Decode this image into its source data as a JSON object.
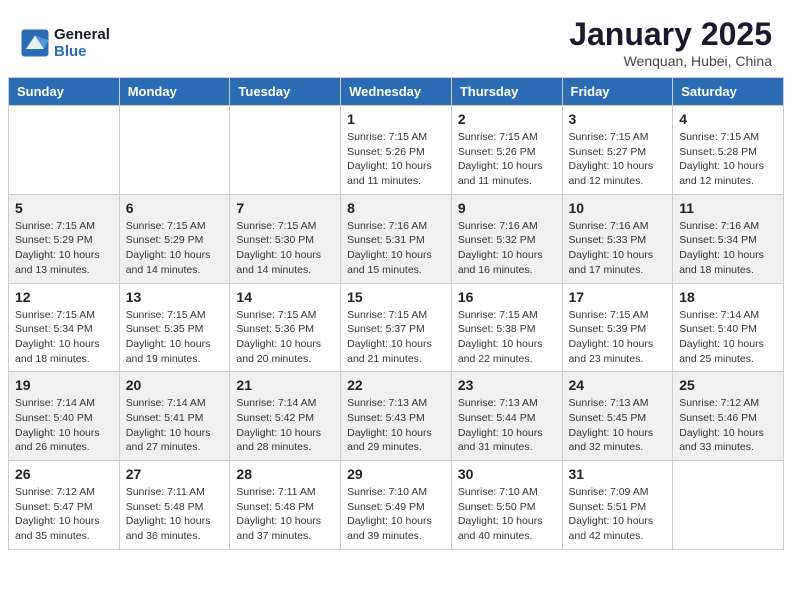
{
  "header": {
    "logo_line1": "General",
    "logo_line2": "Blue",
    "month": "January 2025",
    "location": "Wenquan, Hubei, China"
  },
  "days_of_week": [
    "Sunday",
    "Monday",
    "Tuesday",
    "Wednesday",
    "Thursday",
    "Friday",
    "Saturday"
  ],
  "weeks": [
    {
      "alt": false,
      "days": [
        {
          "num": "",
          "info": ""
        },
        {
          "num": "",
          "info": ""
        },
        {
          "num": "",
          "info": ""
        },
        {
          "num": "1",
          "info": "Sunrise: 7:15 AM\nSunset: 5:26 PM\nDaylight: 10 hours\nand 11 minutes."
        },
        {
          "num": "2",
          "info": "Sunrise: 7:15 AM\nSunset: 5:26 PM\nDaylight: 10 hours\nand 11 minutes."
        },
        {
          "num": "3",
          "info": "Sunrise: 7:15 AM\nSunset: 5:27 PM\nDaylight: 10 hours\nand 12 minutes."
        },
        {
          "num": "4",
          "info": "Sunrise: 7:15 AM\nSunset: 5:28 PM\nDaylight: 10 hours\nand 12 minutes."
        }
      ]
    },
    {
      "alt": true,
      "days": [
        {
          "num": "5",
          "info": "Sunrise: 7:15 AM\nSunset: 5:29 PM\nDaylight: 10 hours\nand 13 minutes."
        },
        {
          "num": "6",
          "info": "Sunrise: 7:15 AM\nSunset: 5:29 PM\nDaylight: 10 hours\nand 14 minutes."
        },
        {
          "num": "7",
          "info": "Sunrise: 7:15 AM\nSunset: 5:30 PM\nDaylight: 10 hours\nand 14 minutes."
        },
        {
          "num": "8",
          "info": "Sunrise: 7:16 AM\nSunset: 5:31 PM\nDaylight: 10 hours\nand 15 minutes."
        },
        {
          "num": "9",
          "info": "Sunrise: 7:16 AM\nSunset: 5:32 PM\nDaylight: 10 hours\nand 16 minutes."
        },
        {
          "num": "10",
          "info": "Sunrise: 7:16 AM\nSunset: 5:33 PM\nDaylight: 10 hours\nand 17 minutes."
        },
        {
          "num": "11",
          "info": "Sunrise: 7:16 AM\nSunset: 5:34 PM\nDaylight: 10 hours\nand 18 minutes."
        }
      ]
    },
    {
      "alt": false,
      "days": [
        {
          "num": "12",
          "info": "Sunrise: 7:15 AM\nSunset: 5:34 PM\nDaylight: 10 hours\nand 18 minutes."
        },
        {
          "num": "13",
          "info": "Sunrise: 7:15 AM\nSunset: 5:35 PM\nDaylight: 10 hours\nand 19 minutes."
        },
        {
          "num": "14",
          "info": "Sunrise: 7:15 AM\nSunset: 5:36 PM\nDaylight: 10 hours\nand 20 minutes."
        },
        {
          "num": "15",
          "info": "Sunrise: 7:15 AM\nSunset: 5:37 PM\nDaylight: 10 hours\nand 21 minutes."
        },
        {
          "num": "16",
          "info": "Sunrise: 7:15 AM\nSunset: 5:38 PM\nDaylight: 10 hours\nand 22 minutes."
        },
        {
          "num": "17",
          "info": "Sunrise: 7:15 AM\nSunset: 5:39 PM\nDaylight: 10 hours\nand 23 minutes."
        },
        {
          "num": "18",
          "info": "Sunrise: 7:14 AM\nSunset: 5:40 PM\nDaylight: 10 hours\nand 25 minutes."
        }
      ]
    },
    {
      "alt": true,
      "days": [
        {
          "num": "19",
          "info": "Sunrise: 7:14 AM\nSunset: 5:40 PM\nDaylight: 10 hours\nand 26 minutes."
        },
        {
          "num": "20",
          "info": "Sunrise: 7:14 AM\nSunset: 5:41 PM\nDaylight: 10 hours\nand 27 minutes."
        },
        {
          "num": "21",
          "info": "Sunrise: 7:14 AM\nSunset: 5:42 PM\nDaylight: 10 hours\nand 28 minutes."
        },
        {
          "num": "22",
          "info": "Sunrise: 7:13 AM\nSunset: 5:43 PM\nDaylight: 10 hours\nand 29 minutes."
        },
        {
          "num": "23",
          "info": "Sunrise: 7:13 AM\nSunset: 5:44 PM\nDaylight: 10 hours\nand 31 minutes."
        },
        {
          "num": "24",
          "info": "Sunrise: 7:13 AM\nSunset: 5:45 PM\nDaylight: 10 hours\nand 32 minutes."
        },
        {
          "num": "25",
          "info": "Sunrise: 7:12 AM\nSunset: 5:46 PM\nDaylight: 10 hours\nand 33 minutes."
        }
      ]
    },
    {
      "alt": false,
      "days": [
        {
          "num": "26",
          "info": "Sunrise: 7:12 AM\nSunset: 5:47 PM\nDaylight: 10 hours\nand 35 minutes."
        },
        {
          "num": "27",
          "info": "Sunrise: 7:11 AM\nSunset: 5:48 PM\nDaylight: 10 hours\nand 36 minutes."
        },
        {
          "num": "28",
          "info": "Sunrise: 7:11 AM\nSunset: 5:48 PM\nDaylight: 10 hours\nand 37 minutes."
        },
        {
          "num": "29",
          "info": "Sunrise: 7:10 AM\nSunset: 5:49 PM\nDaylight: 10 hours\nand 39 minutes."
        },
        {
          "num": "30",
          "info": "Sunrise: 7:10 AM\nSunset: 5:50 PM\nDaylight: 10 hours\nand 40 minutes."
        },
        {
          "num": "31",
          "info": "Sunrise: 7:09 AM\nSunset: 5:51 PM\nDaylight: 10 hours\nand 42 minutes."
        },
        {
          "num": "",
          "info": ""
        }
      ]
    }
  ]
}
